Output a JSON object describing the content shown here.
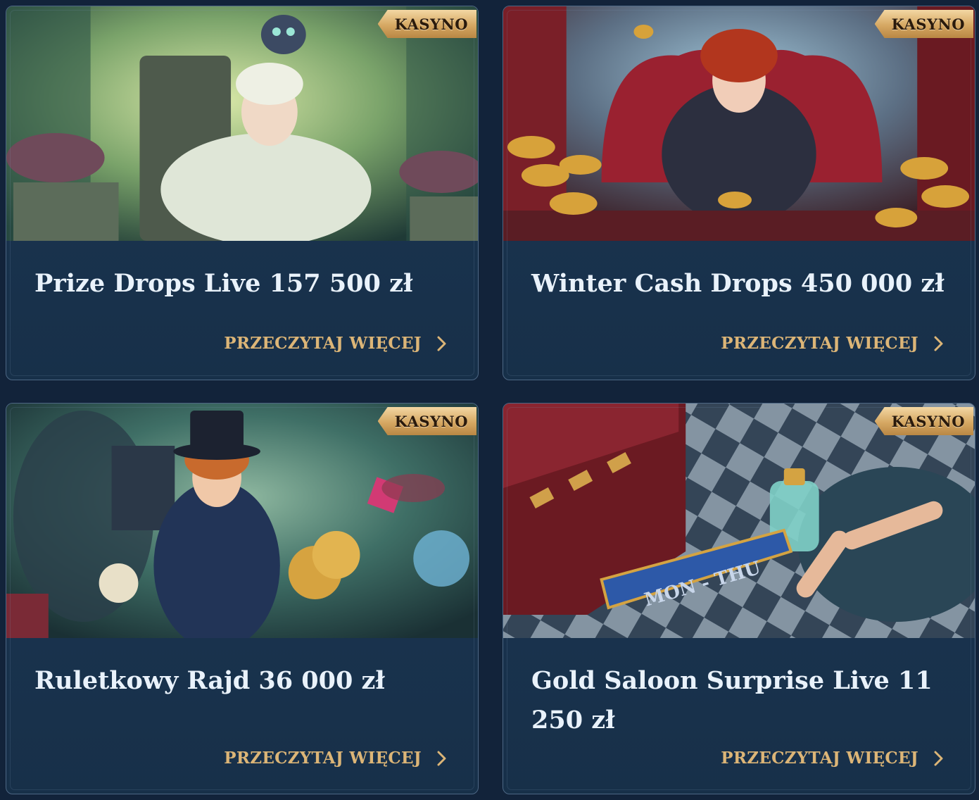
{
  "cards": [
    {
      "badge": "KASYNO",
      "title": "Prize Drops Live 157 500 zł",
      "link": "PRZECZYTAJ WIĘCEJ",
      "image": "queen-throne-cat-illustration"
    },
    {
      "badge": "KASYNO",
      "title": "Winter Cash Drops 450 000 zł",
      "link": "PRZECZYTAJ WIĘCEJ",
      "image": "queen-of-hearts-coins-illustration"
    },
    {
      "badge": "KASYNO",
      "title": "Ruletkowy Rajd 36 000 zł",
      "link": "PRZECZYTAJ WIĘCEJ",
      "image": "mad-hatter-coins-illustration"
    },
    {
      "badge": "KASYNO",
      "title": "Gold Saloon Surprise Live 11 250 zł",
      "link": "PRZECZYTAJ WIĘCEJ",
      "image": "potion-bottle-checkerboard-illustration",
      "banner_text": "MON - THU"
    }
  ],
  "colors": {
    "background": "#12233a",
    "card": "#1c3553",
    "accent": "#dcb577",
    "title": "#e9f2fb"
  },
  "icons": {
    "link_icon": "chevron-right-icon"
  }
}
